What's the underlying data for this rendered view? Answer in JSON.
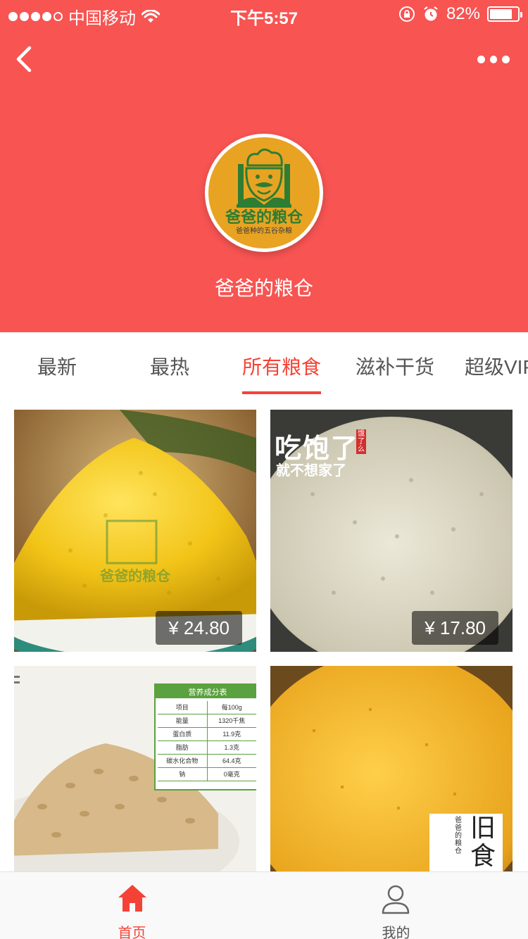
{
  "status_bar": {
    "carrier": "中国移动",
    "time": "下午5:57",
    "battery": "82%",
    "battery_level": 0.82
  },
  "shop": {
    "name": "爸爸的粮仓",
    "logo_title": "爸爸的粮仓",
    "logo_subtitle": "爸爸种的五谷杂粮"
  },
  "tabs": [
    {
      "label": "最新"
    },
    {
      "label": "最热"
    },
    {
      "label": "所有粮食"
    },
    {
      "label": "滋补干货"
    },
    {
      "label": "超级VIP"
    }
  ],
  "products": [
    {
      "price": "¥ 24.80",
      "watermark": "爸爸的粮仓"
    },
    {
      "price": "¥ 17.80",
      "overlay_line1": "吃饱了",
      "overlay_line2": "就不想家了",
      "stamp": "饿了么"
    },
    {
      "table_title": "营养成分表",
      "table_rows": [
        [
          "项目",
          "每100g"
        ],
        [
          "能量",
          "1320千焦"
        ],
        [
          "蛋白质",
          "11.9克"
        ],
        [
          "脂肪",
          "1.3克"
        ],
        [
          "碳水化合物",
          "64.4克"
        ],
        [
          "钠",
          "0毫克"
        ]
      ]
    },
    {
      "label_big": "旧食",
      "label_small": "爸爸的粮仓"
    }
  ],
  "tabbar": {
    "home": "首页",
    "mine": "我的"
  },
  "colors": {
    "brand": "#f75452",
    "active": "#f44336",
    "logo_bg": "#e8a323",
    "logo_green": "#2e7d32"
  }
}
